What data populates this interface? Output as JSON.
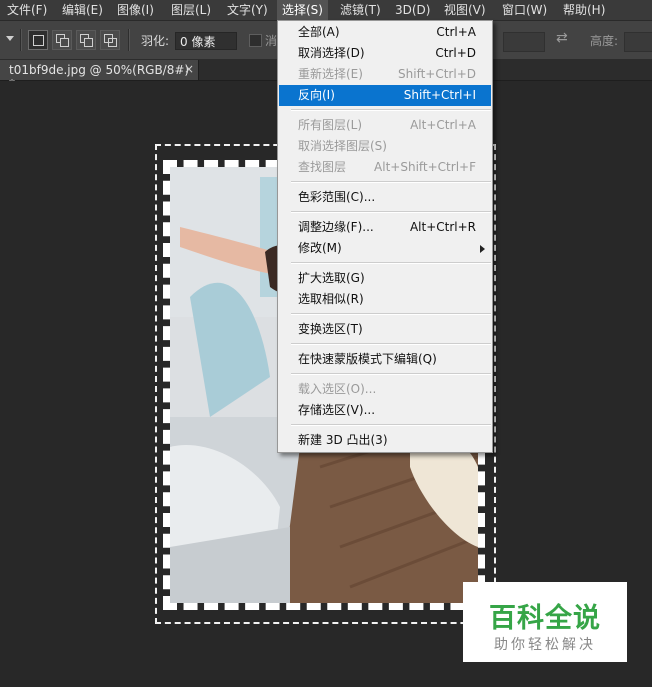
{
  "menubar": {
    "items": [
      {
        "label": "文件(F)"
      },
      {
        "label": "编辑(E)"
      },
      {
        "label": "图像(I)"
      },
      {
        "label": "图层(L)"
      },
      {
        "label": "文字(Y)"
      },
      {
        "label": "选择(S)",
        "active": true
      },
      {
        "label": "滤镜(T)"
      },
      {
        "label": "3D(D)"
      },
      {
        "label": "视图(V)"
      },
      {
        "label": "窗口(W)"
      },
      {
        "label": "帮助(H)"
      }
    ]
  },
  "options": {
    "feather_label": "羽化:",
    "feather_value": "0 像素",
    "antialias_label": "消",
    "height_label": "高度:"
  },
  "document": {
    "tab_title": "t01bf9de.jpg @ 50%(RGB/8#) *",
    "close": "×"
  },
  "select_menu": {
    "items": [
      {
        "label": "全部(A)",
        "shortcut": "Ctrl+A",
        "disabled": false
      },
      {
        "label": "取消选择(D)",
        "shortcut": "Ctrl+D",
        "disabled": false
      },
      {
        "label": "重新选择(E)",
        "shortcut": "Shift+Ctrl+D",
        "disabled": true
      },
      {
        "label": "反向(I)",
        "shortcut": "Shift+Ctrl+I",
        "disabled": false,
        "highlighted": true
      },
      {
        "label": "所有图层(L)",
        "shortcut": "Alt+Ctrl+A",
        "disabled": true
      },
      {
        "label": "取消选择图层(S)",
        "shortcut": "",
        "disabled": true
      },
      {
        "label": "查找图层",
        "shortcut": "Alt+Shift+Ctrl+F",
        "disabled": true
      },
      {
        "label": "色彩范围(C)...",
        "shortcut": "",
        "disabled": false
      },
      {
        "label": "调整边缘(F)...",
        "shortcut": "Alt+Ctrl+R",
        "disabled": false
      },
      {
        "label": "修改(M)",
        "shortcut": "",
        "disabled": false,
        "submenu": true
      },
      {
        "label": "扩大选取(G)",
        "shortcut": "",
        "disabled": false
      },
      {
        "label": "选取相似(R)",
        "shortcut": "",
        "disabled": false
      },
      {
        "label": "变换选区(T)",
        "shortcut": "",
        "disabled": false
      },
      {
        "label": "在快速蒙版模式下编辑(Q)",
        "shortcut": "",
        "disabled": false
      },
      {
        "label": "载入选区(O)...",
        "shortcut": "",
        "disabled": true
      },
      {
        "label": "存储选区(V)...",
        "shortcut": "",
        "disabled": false
      },
      {
        "label": "新建 3D 凸出(3)",
        "shortcut": "",
        "disabled": false
      }
    ]
  },
  "watermark": {
    "title": "百科全说",
    "subtitle": "助你轻松解决"
  },
  "colors": {
    "highlight": "#0a74cf",
    "watermark_green": "#36a547"
  }
}
